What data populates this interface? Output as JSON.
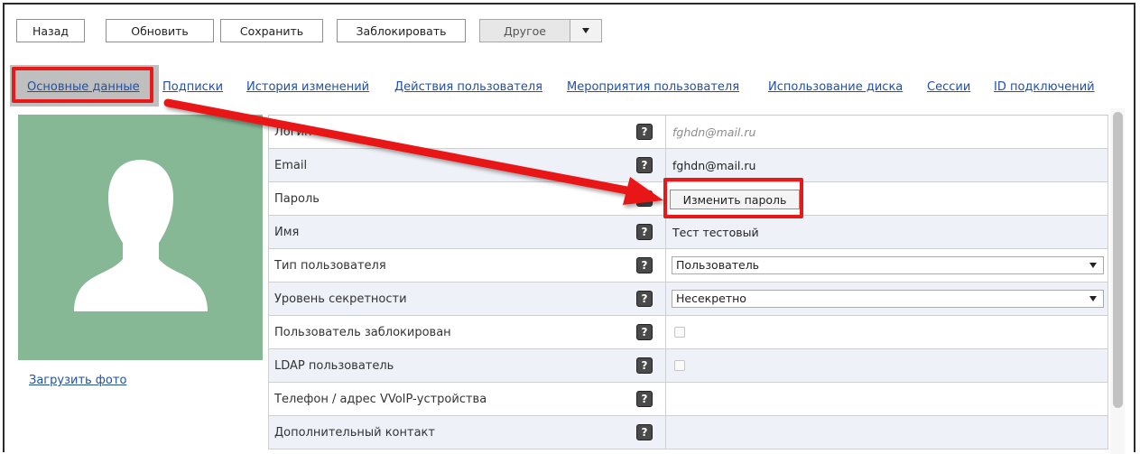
{
  "toolbar": {
    "back": "Назад",
    "refresh": "Обновить",
    "save": "Сохранить",
    "block": "Заблокировать",
    "other": "Другое"
  },
  "tabs": [
    {
      "label": "Основные данные",
      "active": true
    },
    {
      "label": "Подписки"
    },
    {
      "label": "История изменений"
    },
    {
      "label": "Действия пользователя"
    },
    {
      "label": "Мероприятия пользователя"
    },
    {
      "label": "Использование диска"
    },
    {
      "label": "Сессии"
    },
    {
      "label": "ID подключений"
    }
  ],
  "photo": {
    "upload_label": "Загрузить фото"
  },
  "form": {
    "rows": [
      {
        "label": "Логин",
        "value": "fghdn@mail.ru"
      },
      {
        "label": "Email",
        "value": "fghdn@mail.ru"
      },
      {
        "label": "Пароль",
        "button": "Изменить пароль"
      },
      {
        "label": "Имя",
        "value": "Тест тестовый"
      },
      {
        "label": "Тип пользователя",
        "select": "Пользователь"
      },
      {
        "label": "Уровень секретности",
        "select": "Несекретно"
      },
      {
        "label": "Пользователь заблокирован",
        "checked": false
      },
      {
        "label": "LDAP пользователь",
        "checked": false
      },
      {
        "label": "Телефон / адрес VVoIP-устройства",
        "value": ""
      },
      {
        "label": "Дополнительный контакт",
        "value": ""
      }
    ]
  },
  "help_glyph": "?",
  "colors": {
    "annotation_red": "#e81919",
    "link_blue": "#2150a8",
    "avatar_bg": "#86b896",
    "row_alt": "#eef2f8"
  }
}
